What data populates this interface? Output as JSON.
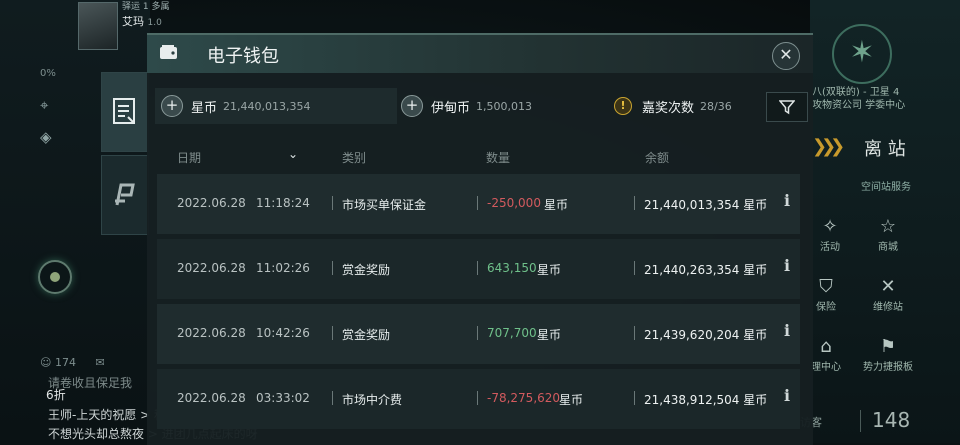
{
  "hud_left": {
    "pilot_tag": "驿运 1 多属",
    "pilot_name": "艾玛",
    "level_text": "1.0",
    "stat_text": "0%",
    "chat_count": "174",
    "chat_line_1": "请卷收且保足我",
    "chat_line_2": "王师-上天的祝愿 > 秋秋现什么驰的呀",
    "chat_line_3": "不想光头却总熬夜 > 进团几点起床的呀",
    "discount": "6折"
  },
  "hud_right": {
    "station_name_1": "八(双联的) - 卫星 4",
    "station_name_2": "攻物资公司 学委中心",
    "undock": "离 站",
    "service_title": "空间站服务",
    "services": [
      {
        "label": "活动",
        "icon": "party-popper-icon"
      },
      {
        "label": "商城",
        "icon": "star-shop-icon"
      },
      {
        "label": "保险",
        "icon": "shield-icon"
      },
      {
        "label": "维修站",
        "icon": "wrench-icon"
      },
      {
        "label": "理中心",
        "icon": "clone-center-icon"
      },
      {
        "label": "势力捷报板",
        "icon": "faction-board-icon"
      }
    ],
    "visitors_label": "访客",
    "visitors_count": "148"
  },
  "dialog": {
    "title": "电子钱包",
    "currencies": [
      {
        "name": "星币",
        "value": "21,440,013,354"
      },
      {
        "name": "伊甸币",
        "value": "1,500,013"
      }
    ],
    "bounty": {
      "label": "嘉奖次数",
      "value": "28/36"
    },
    "columns": {
      "date": "日期",
      "category": "类别",
      "amount": "数量",
      "balance": "余额"
    },
    "rows": [
      {
        "date": "2022.06.28",
        "time": "11:18:24",
        "category": "市场买单保证金",
        "amount": "-250,000",
        "amount_unit": "星币",
        "balance": "21,440,013,354 星币",
        "sign": "neg"
      },
      {
        "date": "2022.06.28",
        "time": "11:02:26",
        "category": "赏金奖励",
        "amount": "643,150",
        "amount_unit": "星币",
        "balance": "21,440,263,354 星币",
        "sign": "pos"
      },
      {
        "date": "2022.06.28",
        "time": "10:42:26",
        "category": "赏金奖励",
        "amount": "707,700",
        "amount_unit": "星币",
        "balance": "21,439,620,204 星币",
        "sign": "pos"
      },
      {
        "date": "2022.06.28",
        "time": "03:33:02",
        "category": "市场中介费",
        "amount": "-78,275,620",
        "amount_unit": "星币",
        "balance": "21,438,912,504 星币",
        "sign": "neg"
      }
    ],
    "info_glyph": "i",
    "close_glyph": "✕",
    "add_glyph": "+",
    "warn_glyph": "!",
    "sort_glyph": "⌄"
  },
  "colors": {
    "negative": "#d25a5e",
    "positive": "#6fc08a",
    "accent": "#c89a2c"
  }
}
